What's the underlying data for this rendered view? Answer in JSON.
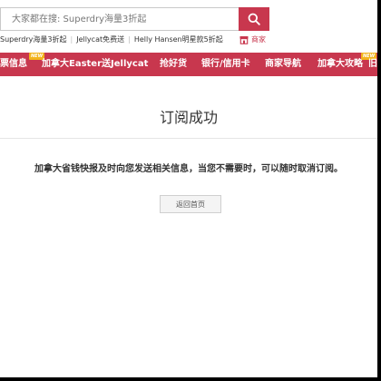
{
  "search": {
    "placeholder": "大家都在搜: Superdry海量3折起",
    "button_icon": "search-icon"
  },
  "hot_links": [
    "Superdry海量3折起",
    "Jellycat免费送",
    "Helly Hansen明星款5折起"
  ],
  "merchant_link": {
    "label": "商家",
    "icon": "store-icon"
  },
  "nav": {
    "items": [
      {
        "label": "票信息",
        "badge": "NEW"
      },
      {
        "label": "加拿大Easter送Jellycat",
        "badge": ""
      },
      {
        "label": "抢好货",
        "badge": ""
      },
      {
        "label": "银行/信用卡",
        "badge": ""
      },
      {
        "label": "商家导航",
        "badge": ""
      },
      {
        "label": "加拿大攻略",
        "badge": "NEW"
      },
      {
        "label": "旧",
        "badge": ""
      }
    ]
  },
  "main": {
    "title": "订阅成功",
    "message": "加拿大省钱快报及时向您发送相关信息，当您不需要时，可以随时取消订阅。",
    "home_button": "返回首页"
  },
  "colors": {
    "brand": "#c8374e",
    "badge": "#f2b41c",
    "text": "#333333"
  }
}
